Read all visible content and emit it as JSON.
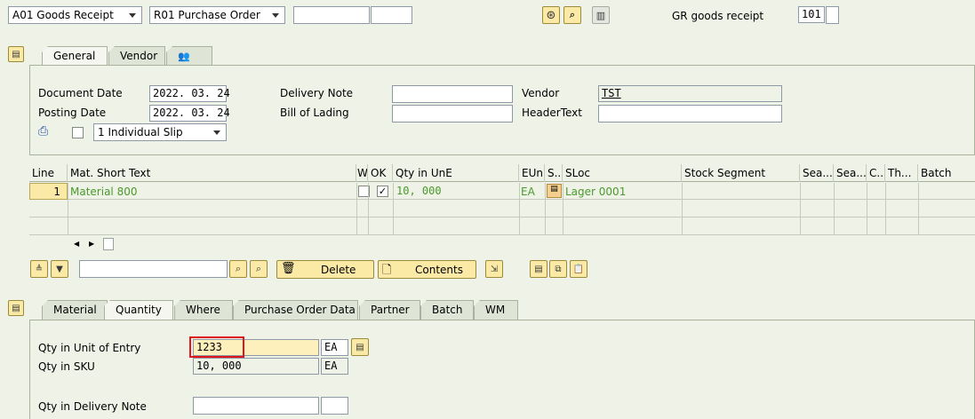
{
  "header": {
    "transaction_select": "A01 Goods Receipt",
    "reference_select": "R01 Purchase Order",
    "gr_label": "GR goods receipt",
    "movement_type": "101"
  },
  "tabs_top": {
    "general": "General",
    "vendor": "Vendor"
  },
  "general": {
    "document_date_label": "Document Date",
    "document_date": "2022. 03. 24",
    "posting_date_label": "Posting Date",
    "posting_date": "2022. 03. 24",
    "delivery_note_label": "Delivery Note",
    "bill_of_lading_label": "Bill of Lading",
    "vendor_label": "Vendor",
    "vendor_value": "TST",
    "header_text_label": "HeaderText",
    "slip_select": "1 Individual Slip"
  },
  "table": {
    "columns": [
      "Line",
      "Mat. Short Text",
      "W",
      "OK",
      "Qty in UnE",
      "EUn",
      "S..",
      "SLoc",
      "Stock Segment",
      "Sea...",
      "Sea...",
      "C..",
      "Th...",
      "Batch"
    ],
    "rows": [
      {
        "line": "1",
        "text": "Material 800",
        "qty": "10, 000",
        "eun": "EA",
        "sloc": "Lager 0001",
        "ok": "✓"
      }
    ]
  },
  "toolbar": {
    "delete": "Delete",
    "contents": "Contents"
  },
  "tabs_bottom": [
    "Material",
    "Quantity",
    "Where",
    "Purchase Order Data",
    "Partner",
    "Batch",
    "WM"
  ],
  "quantity": {
    "qty_entry_label": "Qty in Unit of Entry",
    "qty_entry": "1233",
    "qty_entry_unit": "EA",
    "qty_sku_label": "Qty in SKU",
    "qty_sku": "10, 000",
    "qty_sku_unit": "EA",
    "qty_delivery_label": "Qty in Delivery Note"
  }
}
